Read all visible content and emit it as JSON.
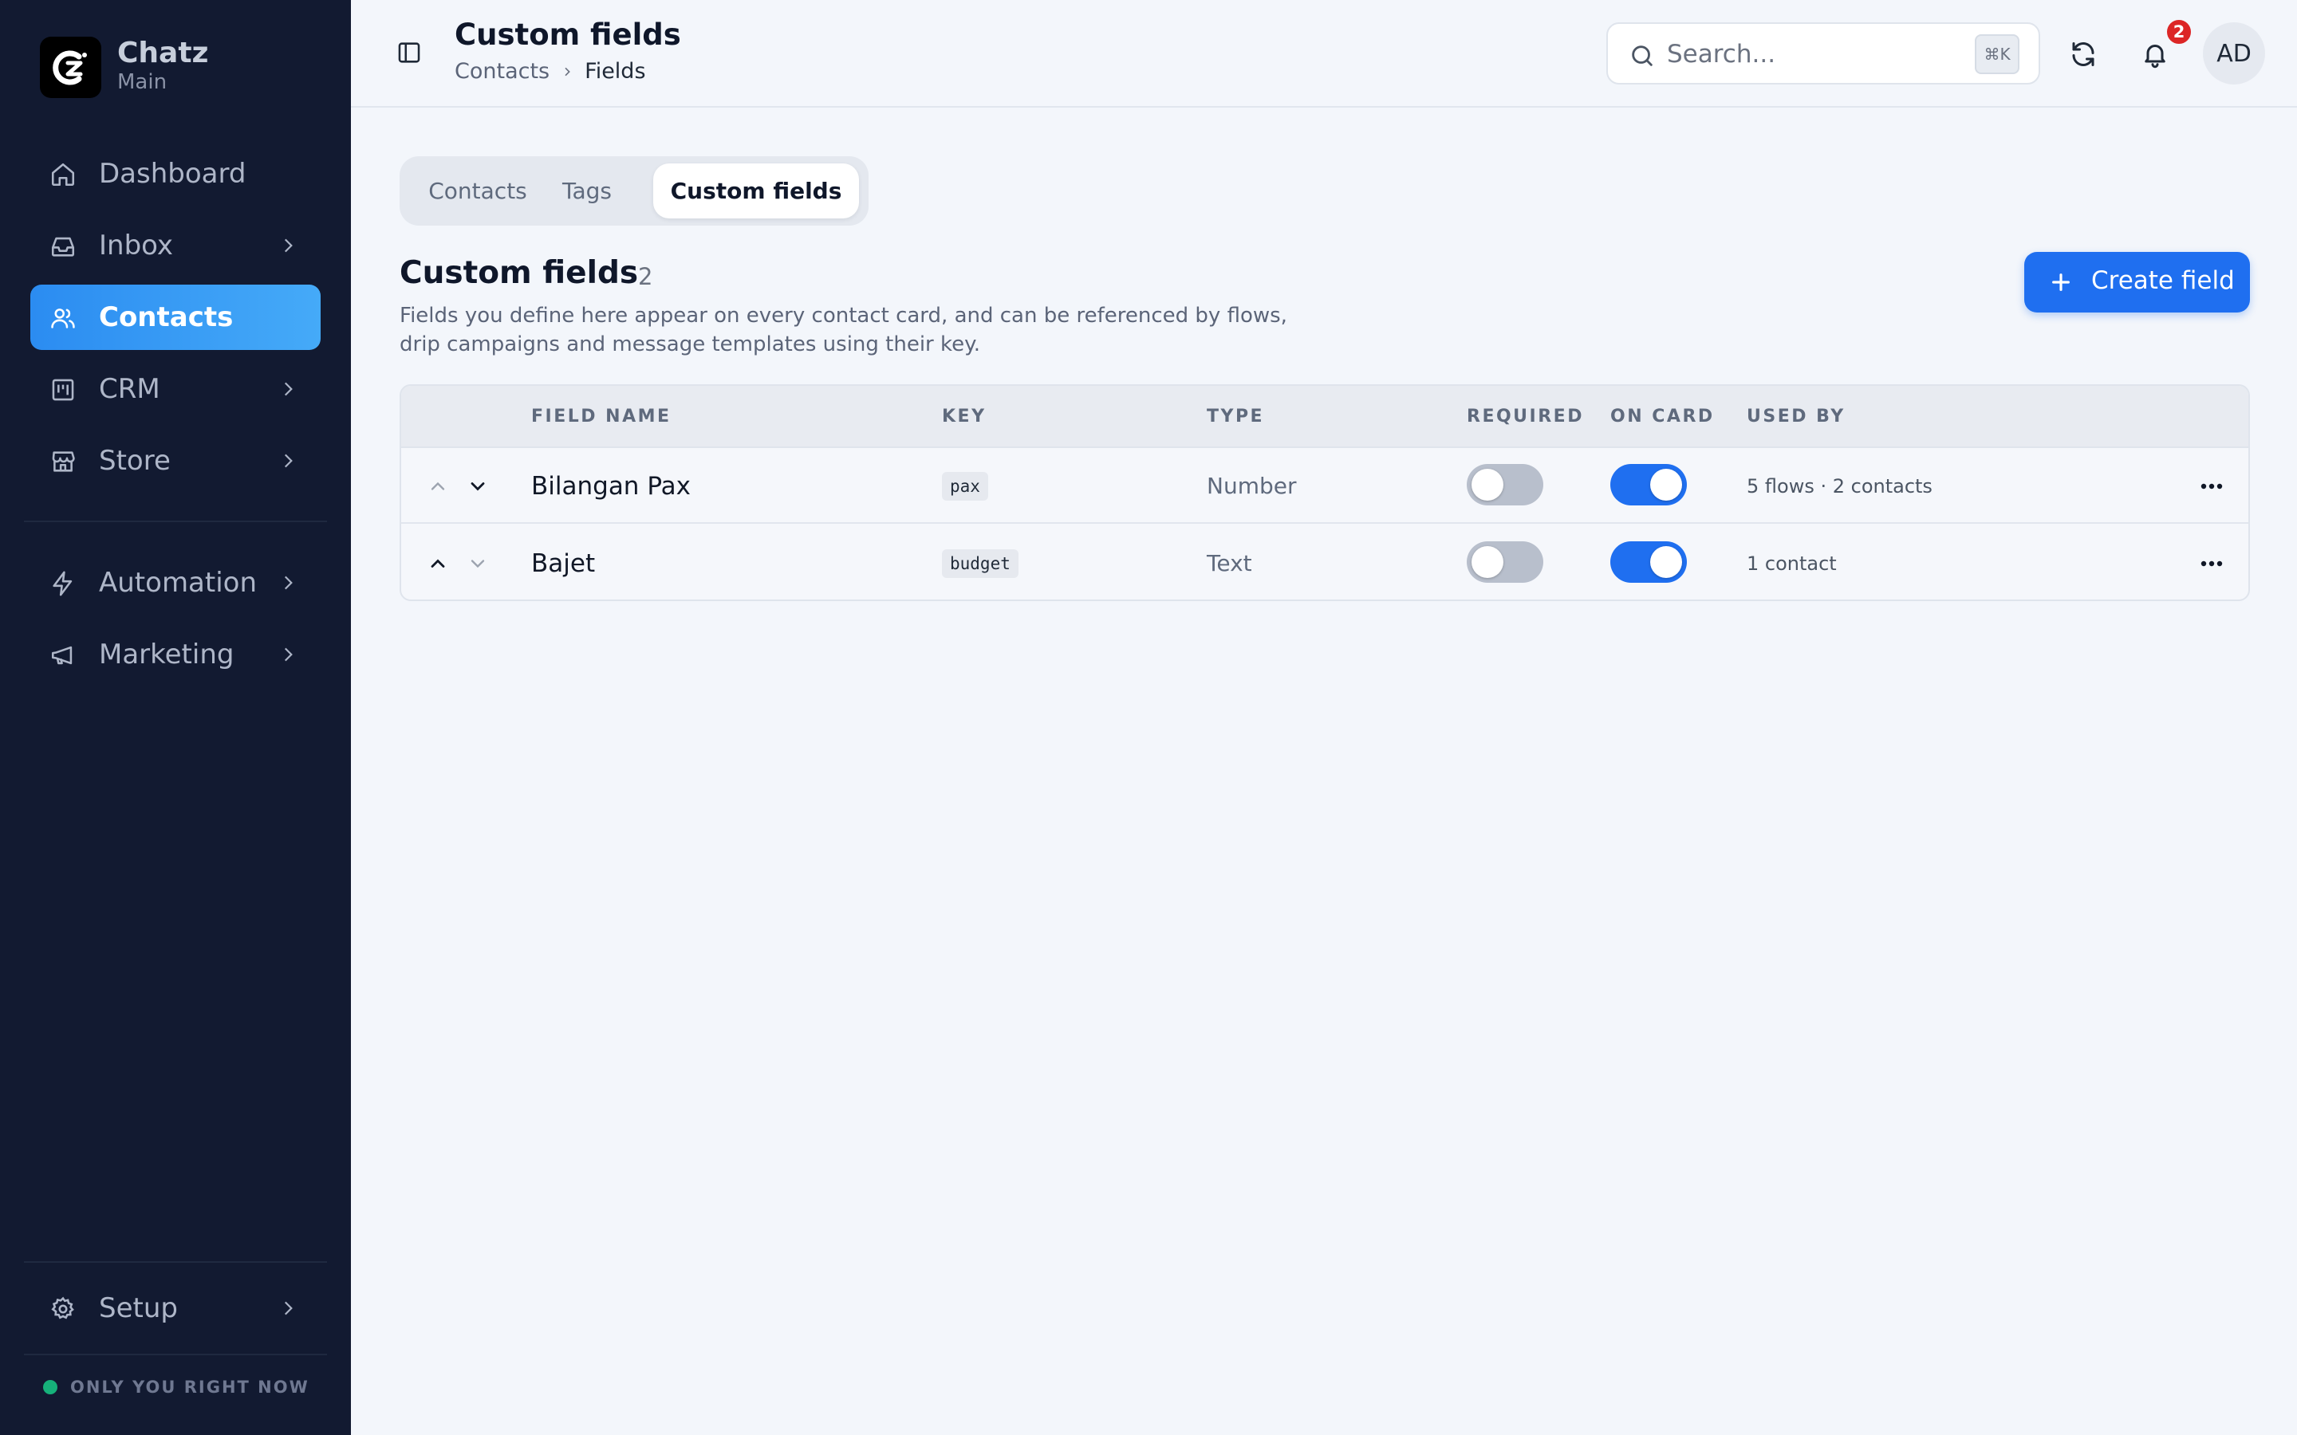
{
  "brand": {
    "name": "Chatz",
    "workspace": "Main"
  },
  "sidebar": {
    "items": [
      {
        "label": "Dashboard",
        "icon": "home-icon",
        "chevron": false,
        "active": false
      },
      {
        "label": "Inbox",
        "icon": "inbox-icon",
        "chevron": true,
        "active": false
      },
      {
        "label": "Contacts",
        "icon": "users-icon",
        "chevron": false,
        "active": true
      },
      {
        "label": "CRM",
        "icon": "kanban-icon",
        "chevron": true,
        "active": false
      },
      {
        "label": "Store",
        "icon": "store-icon",
        "chevron": true,
        "active": false
      },
      {
        "label": "Automation",
        "icon": "bolt-icon",
        "chevron": true,
        "active": false
      },
      {
        "label": "Marketing",
        "icon": "megaphone-icon",
        "chevron": true,
        "active": false
      }
    ],
    "setup_label": "Setup",
    "presence_label": "ONLY YOU RIGHT NOW",
    "presence_color": "#16b17a"
  },
  "header": {
    "title": "Custom fields",
    "breadcrumb": [
      "Contacts",
      "Fields"
    ],
    "search_placeholder": "Search...",
    "search_shortcut": "⌘K",
    "notification_count": "2",
    "avatar_initials": "AD"
  },
  "tabs": [
    "Contacts",
    "Tags",
    "Custom fields"
  ],
  "active_tab": "Custom fields",
  "section": {
    "title": "Custom fields",
    "count": "2",
    "description": "Fields you define here appear on every contact card, and can be referenced by flows, drip campaigns and message templates using their key.",
    "create_label": "Create field"
  },
  "table": {
    "columns": [
      "FIELD NAME",
      "KEY",
      "TYPE",
      "REQUIRED",
      "ON CARD",
      "USED BY"
    ],
    "rows": [
      {
        "name": "Bilangan Pax",
        "key": "pax",
        "type": "Number",
        "required": false,
        "on_card": true,
        "used_by": "5 flows · 2 contacts"
      },
      {
        "name": "Bajet",
        "key": "budget",
        "type": "Text",
        "required": false,
        "on_card": true,
        "used_by": "1 contact"
      }
    ]
  },
  "colors": {
    "sidebar_bg": "#121a31",
    "accent": "#1f6ff0",
    "active_nav": "#2b8cf1",
    "badge": "#dc2626"
  }
}
